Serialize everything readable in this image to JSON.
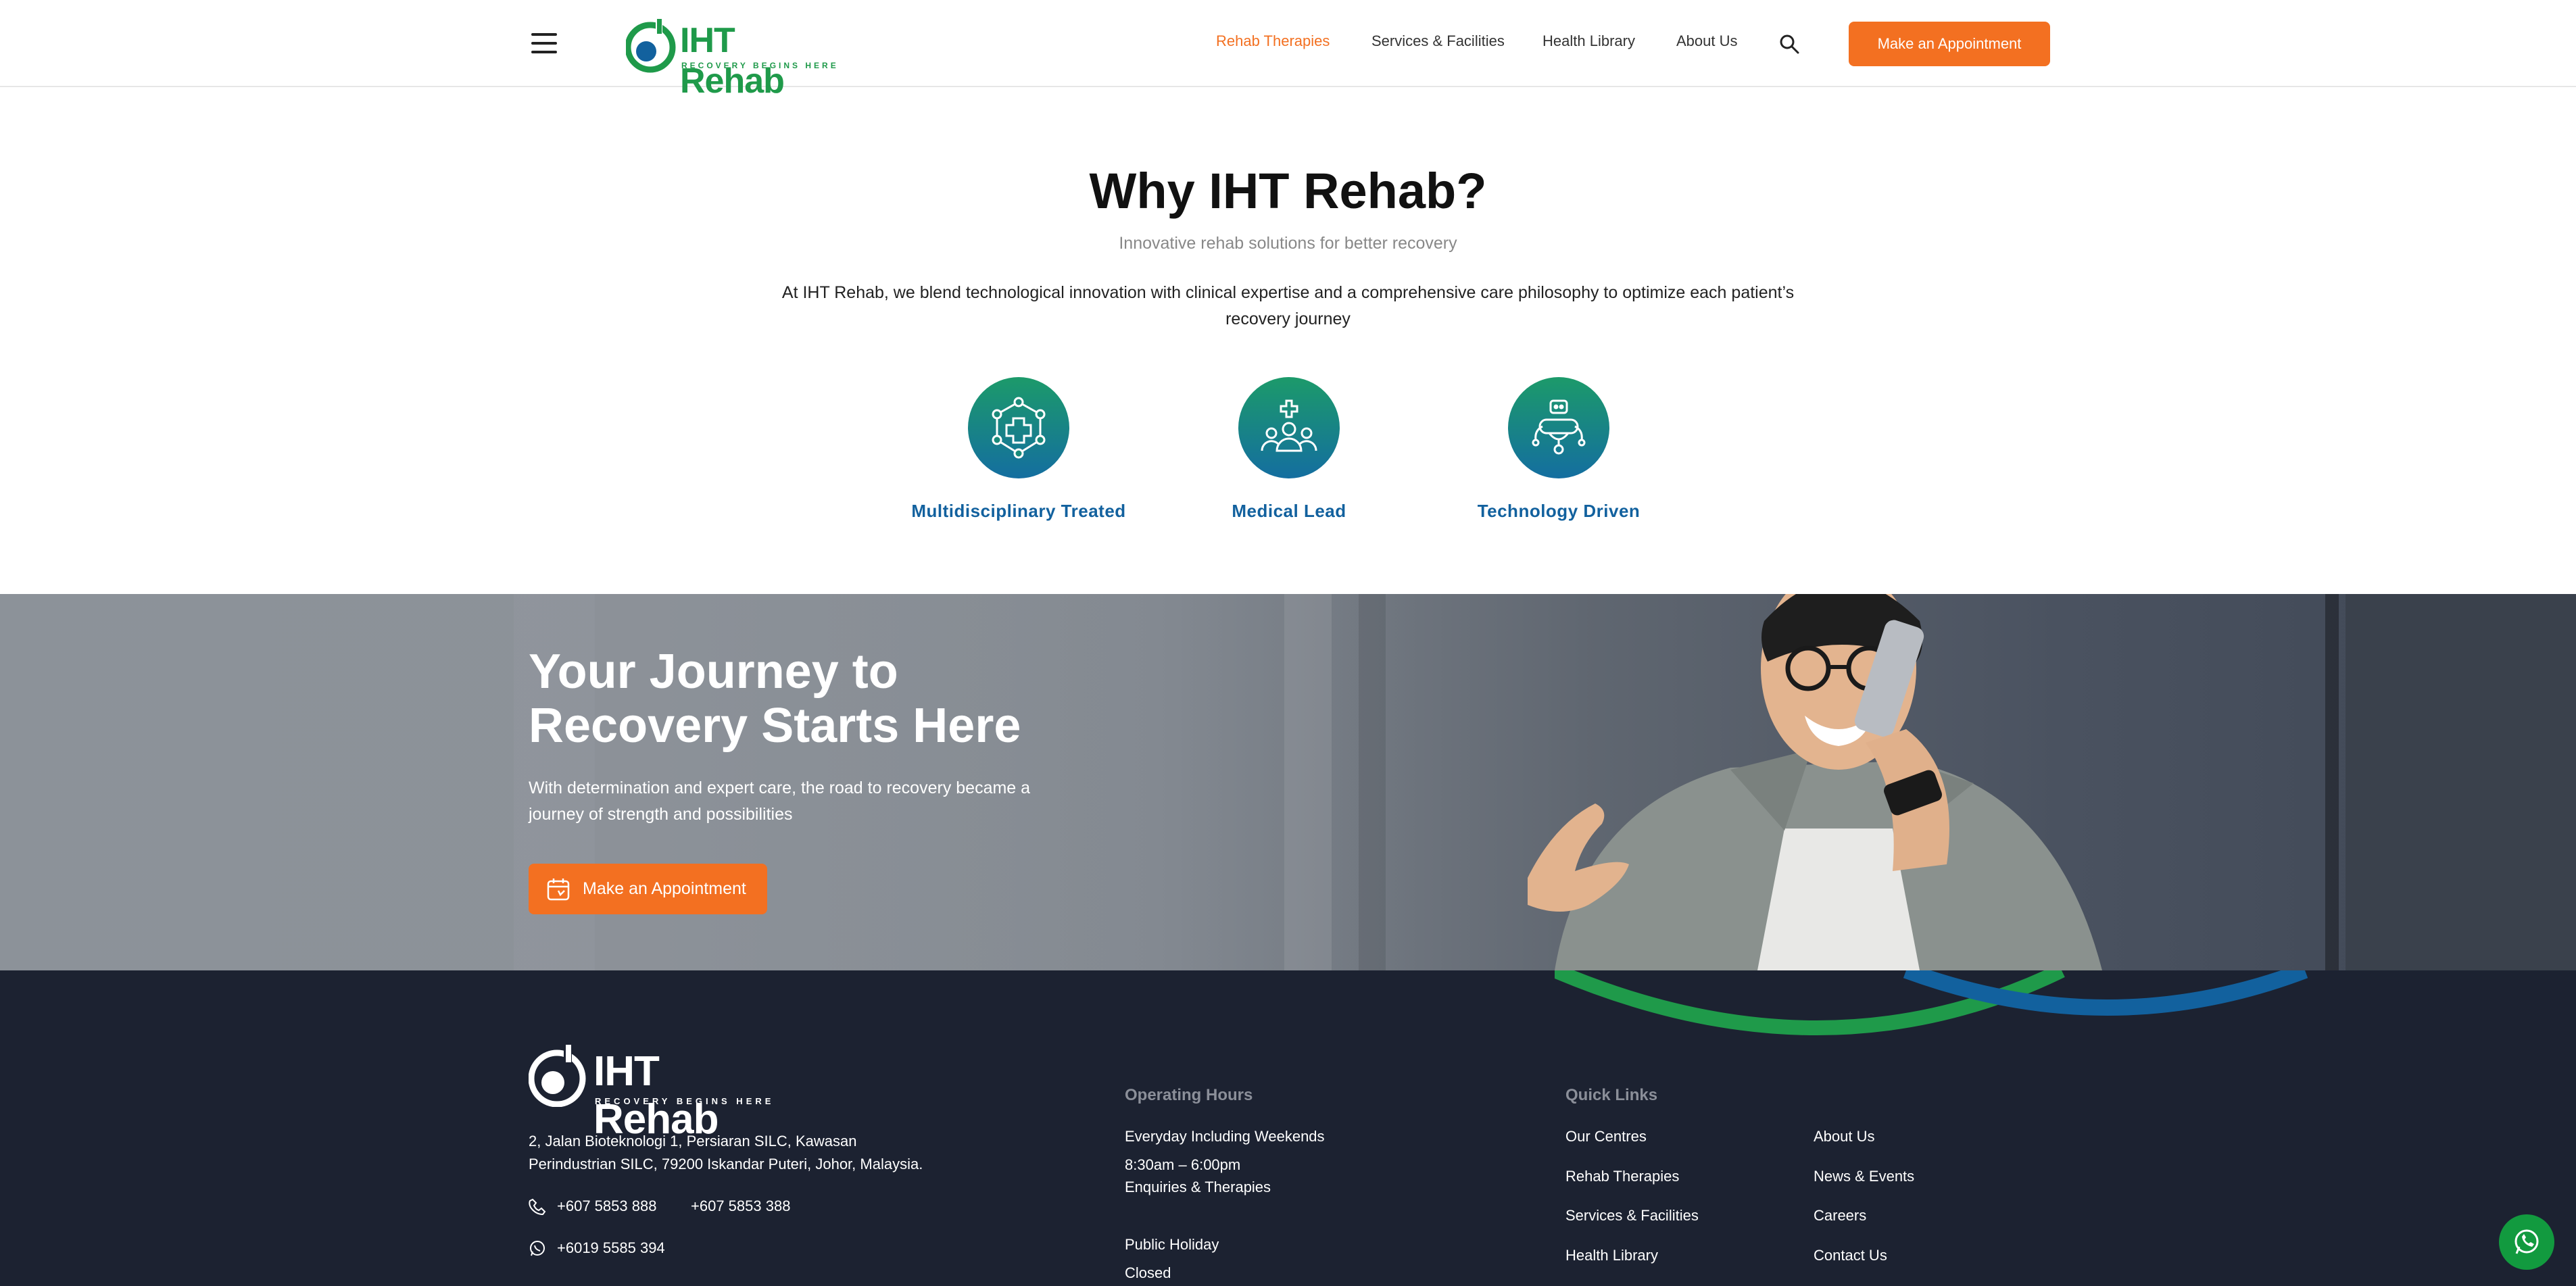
{
  "header": {
    "logo_text": "IHT Rehab",
    "logo_tagline": "RECOVERY BEGINS HERE",
    "nav": [
      {
        "label": "Rehab Therapies"
      },
      {
        "label": "Services & Facilities"
      },
      {
        "label": "Health Library"
      },
      {
        "label": "About Us"
      }
    ],
    "cta": "Make an Appointment"
  },
  "why": {
    "title": "Why IHT Rehab?",
    "subtitle": "Innovative rehab solutions for better recovery",
    "description": "At IHT Rehab, we blend technological innovation with clinical expertise and a comprehensive care philosophy to optimize each patient’s recovery journey",
    "features": [
      {
        "label": "Multidisciplinary Treated",
        "icon": "medical-network-icon"
      },
      {
        "label": "Medical Lead",
        "icon": "medical-team-icon"
      },
      {
        "label": "Technology Driven",
        "icon": "robot-icon"
      }
    ]
  },
  "hero": {
    "title_line1": "Your Journey to",
    "title_line2": "Recovery Starts Here",
    "description": "With determination and expert care, the road to recovery became a journey of strength and possibilities",
    "cta": "Make an Appointment"
  },
  "footer": {
    "logo_text": "IHT Rehab",
    "logo_tagline": "RECOVERY BEGINS HERE",
    "address": "2, Jalan Bioteknologi 1, Persiaran SILC, Kawasan Perindustrian SILC, 79200 Iskandar Puteri, Johor, Malaysia.",
    "phone1": "+607 5853 888",
    "phone2": "+607 5853 388",
    "whatsapp": "+6019 5585 394",
    "hours_heading": "Operating Hours",
    "hours_days": "Everyday Including Weekends",
    "hours_time": "8:30am – 6:00pm",
    "hours_note": "Enquiries & Therapies",
    "holiday_label": "Public Holiday",
    "holiday_status": "Closed",
    "quick_links_heading": "Quick Links",
    "links_col1": [
      "Our Centres",
      "Rehab Therapies",
      "Services & Facilities",
      "Health Library"
    ],
    "links_col2": [
      "About Us",
      "News & Events",
      "Careers",
      "Contact Us"
    ]
  },
  "colors": {
    "accent": "#f37021",
    "brand_green": "#1f9a4a",
    "brand_blue": "#12619e",
    "footer_bg": "#1c2231"
  }
}
